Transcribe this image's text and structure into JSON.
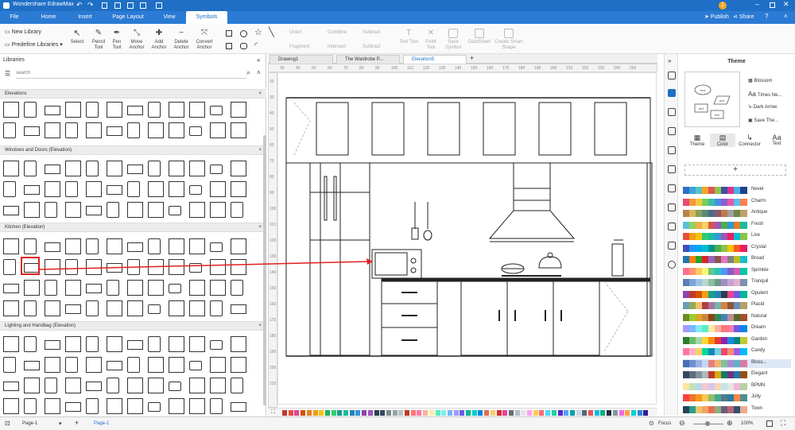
{
  "app": {
    "title": "Wondershare EdrawMax",
    "user_initial": "1"
  },
  "menu": {
    "tabs": [
      "File",
      "Home",
      "Insert",
      "Page Layout",
      "View",
      "Symbols"
    ],
    "active": "Symbols",
    "publish": "Publish",
    "share": "Share"
  },
  "ribbon": {
    "new_library": "New Library",
    "predefine": "Predefine Libraries",
    "select": "Select",
    "pencil": "Pencil Tool",
    "pen": "Pen Tool",
    "move_anchor": "Move Anchor",
    "add_anchor": "Add Anchor",
    "delete_anchor": "Delete Anchor",
    "convert_anchor": "Convert Anchor",
    "union": "Union",
    "combine": "Combine",
    "subtract": "Subtract",
    "fragment": "Fragment",
    "intersect": "Intersect",
    "subtract2": "Subtract",
    "text_tool": "Text Tool",
    "point_tool": "Point Tool",
    "save_symbol": "Save Symbol",
    "datasheet": "DataSheet",
    "smart_shape": "Create Smart Shape"
  },
  "libraries": {
    "title": "Libraries",
    "search_placeholder": "search",
    "sections": [
      "Elevations",
      "Windows and Doors (Elevation)",
      "Kitchen (Elevation)",
      "Lighting and Handbag (Elevation)"
    ]
  },
  "doc_tabs": [
    "Drawing1",
    "The Wardrobe P...",
    "Elevation5"
  ],
  "ruler_top": [
    "30",
    "40",
    "50",
    "60",
    "70",
    "80",
    "90",
    "100",
    "110",
    "120",
    "130",
    "140",
    "150",
    "160",
    "170",
    "180",
    "190",
    "200",
    "210",
    "220",
    "230",
    "240",
    "250"
  ],
  "ruler_left": [
    "20",
    "30",
    "40",
    "50",
    "60",
    "70",
    "80",
    "90",
    "100",
    "110",
    "120",
    "130",
    "140",
    "150",
    "160",
    "170",
    "180",
    "190",
    "200",
    "210"
  ],
  "theme_panel": {
    "title": "Theme",
    "options": [
      "Blossom",
      "Times Ne...",
      "Dark Arrow",
      "Save The..."
    ],
    "tabs": [
      "Theme",
      "Color",
      "Connector",
      "Text"
    ],
    "active_tab": "Color",
    "preview_labels": [
      "text",
      "text",
      "text",
      "text"
    ],
    "themes": [
      {
        "name": "Nevel",
        "colors": [
          "#2d6ec9",
          "#3fa0e0",
          "#5cc2c5",
          "#f5a623",
          "#e25555",
          "#8fc54a",
          "#3d4fa0",
          "#d8358b",
          "#4ab0e5",
          "#1f3f8f"
        ]
      },
      {
        "name": "Charm",
        "colors": [
          "#e94b6f",
          "#f29a3b",
          "#f2cb3b",
          "#7ccf5a",
          "#3bbfa5",
          "#4a90e2",
          "#8c5cd6",
          "#e05aa8",
          "#5bc0eb",
          "#ff7f50"
        ]
      },
      {
        "name": "Antique",
        "colors": [
          "#b5854b",
          "#d9b45a",
          "#8aa05a",
          "#5a8a7a",
          "#4a6a8a",
          "#8a5a6a",
          "#c27a4a",
          "#a0a0a0",
          "#6a8a4a",
          "#c0a06a"
        ]
      },
      {
        "name": "Fresh",
        "colors": [
          "#5bc0de",
          "#8dd35f",
          "#f0ad4e",
          "#f7d35c",
          "#d9534f",
          "#9b59b6",
          "#4cae4c",
          "#2e9ad0",
          "#e67e22",
          "#1abc9c"
        ]
      },
      {
        "name": "Live",
        "colors": [
          "#e74c3c",
          "#f39c12",
          "#f1c40f",
          "#2ecc71",
          "#1abc9c",
          "#3498db",
          "#9b59b6",
          "#e91e63",
          "#00bcd4",
          "#8bc34a"
        ]
      },
      {
        "name": "Crystal",
        "colors": [
          "#3f51b5",
          "#2196f3",
          "#03a9f4",
          "#00bcd4",
          "#009688",
          "#4caf50",
          "#8bc34a",
          "#ffc107",
          "#ff5722",
          "#e91e63"
        ]
      },
      {
        "name": "Broad",
        "colors": [
          "#1f77b4",
          "#ff7f0e",
          "#2ca02c",
          "#d62728",
          "#9467bd",
          "#8c564b",
          "#e377c2",
          "#7f7f7f",
          "#bcbd22",
          "#17becf"
        ]
      },
      {
        "name": "Sprinkle",
        "colors": [
          "#ff6f91",
          "#ff9671",
          "#ffc75f",
          "#f9f871",
          "#67c587",
          "#2ec4b6",
          "#4d96ff",
          "#845ec2",
          "#d65db1",
          "#00c9a7"
        ]
      },
      {
        "name": "Tranquil",
        "colors": [
          "#5b7fb5",
          "#7aa6d6",
          "#9cc3e4",
          "#b8d8c8",
          "#8bbf9f",
          "#6c9a8b",
          "#a38cc6",
          "#c6a3d6",
          "#e0b3c9",
          "#7d8fb3"
        ]
      },
      {
        "name": "Opulent",
        "colors": [
          "#8e44ad",
          "#c0392b",
          "#d35400",
          "#f39c12",
          "#16a085",
          "#2980b9",
          "#2c3e50",
          "#e84393",
          "#6c5ce7",
          "#00b894"
        ]
      },
      {
        "name": "Placid",
        "colors": [
          "#6a9fb5",
          "#90a959",
          "#f4bf75",
          "#ac4142",
          "#aa759f",
          "#75b5aa",
          "#d28445",
          "#8f5536",
          "#6a8fb5",
          "#b5a06a"
        ]
      },
      {
        "name": "Natural",
        "colors": [
          "#6b8e23",
          "#9acd32",
          "#daa520",
          "#cd853f",
          "#8b4513",
          "#2e8b57",
          "#4682b4",
          "#bc8f8f",
          "#556b2f",
          "#a0522d"
        ]
      },
      {
        "name": "Dream",
        "colors": [
          "#a29bfe",
          "#74b9ff",
          "#81ecec",
          "#55efc4",
          "#ffeaa7",
          "#fab1a0",
          "#ff7675",
          "#fd79a8",
          "#6c5ce7",
          "#0984e3"
        ]
      },
      {
        "name": "Garden",
        "colors": [
          "#2e7d32",
          "#66bb6a",
          "#a5d6a7",
          "#fdd835",
          "#fb8c00",
          "#e53935",
          "#8e24aa",
          "#1e88e5",
          "#00897b",
          "#c0ca33"
        ]
      },
      {
        "name": "Candy",
        "colors": [
          "#ff77a9",
          "#ffb3c6",
          "#ffd166",
          "#06d6a0",
          "#118ab2",
          "#73d2de",
          "#ef476f",
          "#f78c6b",
          "#9b5de5",
          "#00bbf9"
        ]
      },
      {
        "name": "Bloss...",
        "colors": [
          "#4a6fb5",
          "#6d8fd1",
          "#9ab4e6",
          "#c7d6f2",
          "#e87e7e",
          "#f2b36b",
          "#7cc29a",
          "#a98bd3",
          "#5fb3c7",
          "#d97aa6"
        ]
      },
      {
        "name": "Elegant",
        "colors": [
          "#34495e",
          "#5d6d7e",
          "#85929e",
          "#aeb6bf",
          "#c0392b",
          "#d4ac0d",
          "#117a65",
          "#6c3483",
          "#2874a6",
          "#935116"
        ]
      },
      {
        "name": "BPMN",
        "colors": [
          "#fbe5a0",
          "#c6e2b5",
          "#bcd6f0",
          "#f6c9c9",
          "#d9c6ee",
          "#f7d7b2",
          "#c2e7e7",
          "#e6e6e6",
          "#f2b8d6",
          "#b5d3a8"
        ]
      },
      {
        "name": "Jolly",
        "colors": [
          "#f94144",
          "#f3722c",
          "#f8961e",
          "#f9c74f",
          "#90be6d",
          "#43aa8b",
          "#577590",
          "#277da1",
          "#f9844a",
          "#4d908e"
        ]
      },
      {
        "name": "Town",
        "colors": [
          "#264653",
          "#2a9d8f",
          "#e9c46a",
          "#f4a261",
          "#e76f51",
          "#8ab17d",
          "#6d597a",
          "#b56576",
          "#355070",
          "#eaac8b"
        ]
      }
    ],
    "selected_theme": "Bloss..."
  },
  "palette_colors": [
    "#c0392b",
    "#e74c3c",
    "#e84393",
    "#d35400",
    "#e67e22",
    "#f39c12",
    "#f1c40f",
    "#27ae60",
    "#2ecc71",
    "#16a085",
    "#1abc9c",
    "#2980b9",
    "#3498db",
    "#8e44ad",
    "#9b59b6",
    "#2c3e50",
    "#34495e",
    "#7f8c8d",
    "#95a5a6",
    "#bdc3c7",
    "#c0392b",
    "#ff7675",
    "#fd79a8",
    "#fab1a0",
    "#ffeaa7",
    "#55efc4",
    "#81ecec",
    "#74b9ff",
    "#a29bfe",
    "#6c5ce7",
    "#00b894",
    "#00cec9",
    "#0984e3",
    "#e17055",
    "#fdcb6e",
    "#d63031",
    "#e84393",
    "#636e72",
    "#b2bec3",
    "#dfe6e9",
    "#ff9ff3",
    "#feca57",
    "#ff6b6b",
    "#48dbfb",
    "#1dd1a1",
    "#5f27cd",
    "#54a0ff",
    "#01a3a4",
    "#c8d6e5",
    "#576574",
    "#ee5253",
    "#0abde3",
    "#10ac84",
    "#222f3e",
    "#8395a7",
    "#f368e0",
    "#ff9f43",
    "#00d2d3",
    "#2e86de",
    "#341f97"
  ],
  "status": {
    "page_selector": "Page-1",
    "page_tab": "Page-1",
    "focus": "Focus",
    "zoom": "100%"
  },
  "accent": "#1f6fc6"
}
